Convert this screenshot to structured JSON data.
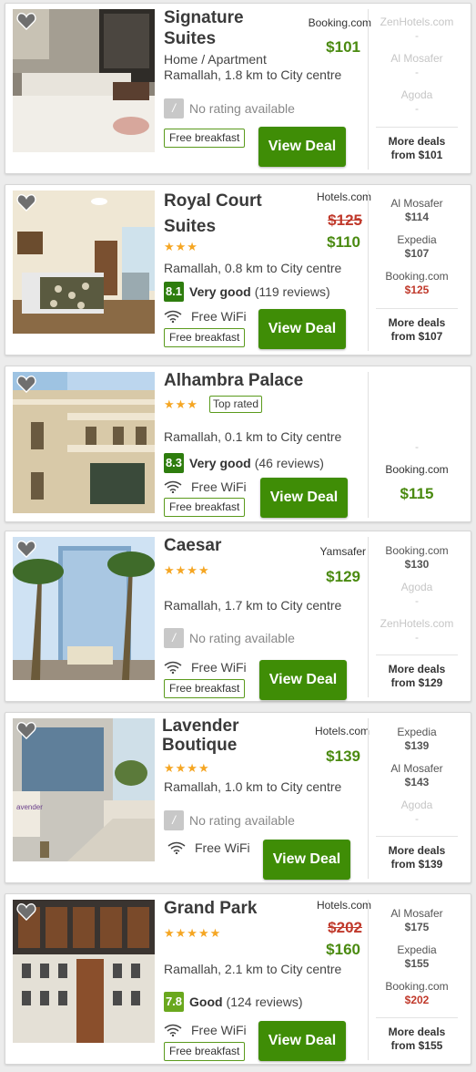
{
  "common": {
    "view_deal": "View Deal",
    "free_breakfast": "Free breakfast",
    "free_wifi": "Free WiFi",
    "no_rating": "No rating available",
    "more_deals_label": "More deals",
    "dash": "-"
  },
  "colors": {
    "green": "#3f8d06",
    "price_green": "#4a8a10",
    "old_red": "#c0392b",
    "star": "#f5a623"
  },
  "hotels": [
    {
      "name": "Signature Suites",
      "provider": "Booking.com",
      "price": "$101",
      "type": "Home / Apartment",
      "location": "Ramallah, 1.8 km to City centre",
      "alternatives": [
        {
          "name": "ZenHotels.com",
          "price": "-"
        },
        {
          "name": "Al Mosafer",
          "price": "-"
        },
        {
          "name": "Agoda",
          "price": "-"
        }
      ],
      "more_from": "from $101"
    },
    {
      "name": "Royal Court Suites",
      "provider": "Hotels.com",
      "old_price": "$125",
      "price": "$110",
      "stars": "★★★",
      "location": "Ramallah, 0.8 km to City centre",
      "score": "8.1",
      "score_label": "Very good",
      "reviews": "(119 reviews)",
      "alternatives": [
        {
          "name": "Al Mosafer",
          "price": "$114"
        },
        {
          "name": "Expedia",
          "price": "$107"
        },
        {
          "name": "Booking.com",
          "price": "$125"
        }
      ],
      "more_from": "from $107"
    },
    {
      "name": "Alhambra Palace",
      "stars": "★★★",
      "badge": "Top rated",
      "location": "Ramallah, 0.1 km to City centre",
      "score": "8.3",
      "score_label": "Very good",
      "reviews": "(46 reviews)",
      "side_provider": "Booking.com",
      "side_price": "$115"
    },
    {
      "name": "Caesar",
      "provider": "Yamsafer",
      "price": "$129",
      "stars": "★★★★",
      "location": "Ramallah, 1.7 km to City centre",
      "alternatives": [
        {
          "name": "Booking.com",
          "price": "$130"
        },
        {
          "name": "Agoda",
          "price": "-"
        },
        {
          "name": "ZenHotels.com",
          "price": "-"
        }
      ],
      "more_from": "from $129"
    },
    {
      "name": "Lavender Boutique",
      "provider": "Hotels.com",
      "price": "$139",
      "stars": "★★★★",
      "location": "Ramallah, 1.0 km to City centre",
      "alternatives": [
        {
          "name": "Expedia",
          "price": "$139"
        },
        {
          "name": "Al Mosafer",
          "price": "$143"
        },
        {
          "name": "Agoda",
          "price": "-"
        }
      ],
      "more_from": "from $139"
    },
    {
      "name": "Grand Park",
      "provider": "Hotels.com",
      "old_price": "$202",
      "price": "$160",
      "stars": "★★★★★",
      "location": "Ramallah, 2.1 km to City centre",
      "score": "7.8",
      "score_label": "Good",
      "reviews": "(124 reviews)",
      "alternatives": [
        {
          "name": "Al Mosafer",
          "price": "$175"
        },
        {
          "name": "Expedia",
          "price": "$155"
        },
        {
          "name": "Booking.com",
          "price": "$202"
        }
      ],
      "more_from": "from $155"
    }
  ]
}
